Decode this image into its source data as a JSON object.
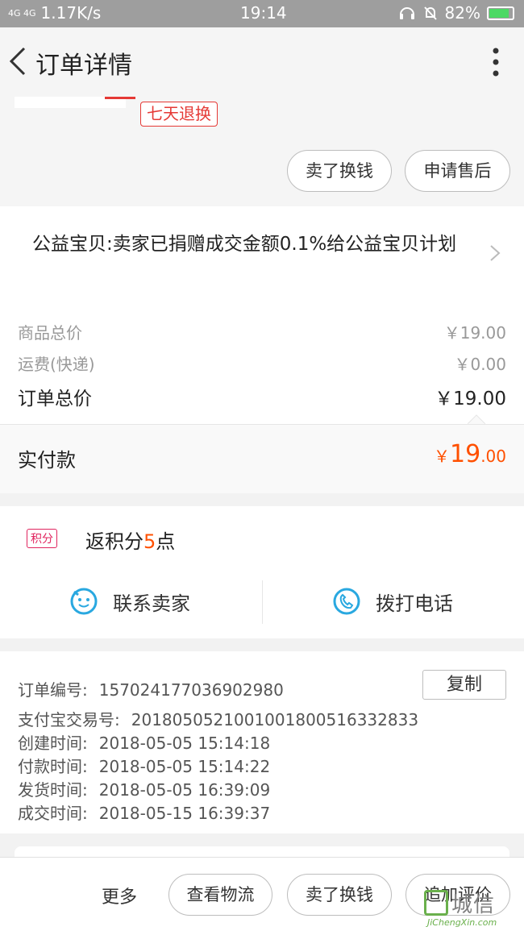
{
  "status_bar": {
    "signal": "4G 4G",
    "speed": "1.17K/s",
    "time": "19:14",
    "battery": "82%"
  },
  "header": {
    "title": "订单详情"
  },
  "item": {
    "return_tag": "七天退换",
    "sell_button": "卖了换钱",
    "after_sale_button": "申请售后"
  },
  "charity": {
    "text": "公益宝贝:卖家已捐赠成交金额0.1%给公益宝贝计划"
  },
  "price": {
    "goods_label": "商品总价",
    "goods_value": "￥19.00",
    "shipping_label": "运费(快递)",
    "shipping_value": "￥0.00",
    "total_label": "订单总价",
    "total_value": "￥19.00",
    "paid_label": "实付款",
    "paid_currency": "￥",
    "paid_int": "19",
    "paid_dec": ".00"
  },
  "points": {
    "badge": "积分",
    "text_prefix": "返积分",
    "value": "5",
    "text_suffix": "点"
  },
  "contact": {
    "seller_label": "联系卖家",
    "phone_label": "拨打电话"
  },
  "order_info": {
    "copy_button": "复制",
    "rows": [
      {
        "label": "订单编号:",
        "value": "157024177036902980"
      },
      {
        "label": "支付宝交易号:",
        "value": "2018050521001001800516332833"
      },
      {
        "label": "创建时间:",
        "value": "2018-05-05 15:14:18"
      },
      {
        "label": "付款时间:",
        "value": "2018-05-05 15:14:22"
      },
      {
        "label": "发货时间:",
        "value": "2018-05-05 16:39:09"
      },
      {
        "label": "成交时间:",
        "value": "2018-05-15 16:39:37"
      }
    ]
  },
  "bottom_bar": {
    "more": "更多",
    "logistics_button": "查看物流",
    "sell_button": "卖了换钱",
    "review_button": "追加评价"
  },
  "watermark": {
    "text": "城信",
    "url": "JiChengXin.com"
  },
  "colors": {
    "accent": "#ff5000",
    "red": "#e53935",
    "icon_blue": "#29a8e0",
    "statusbar": "#9e9e9e"
  }
}
